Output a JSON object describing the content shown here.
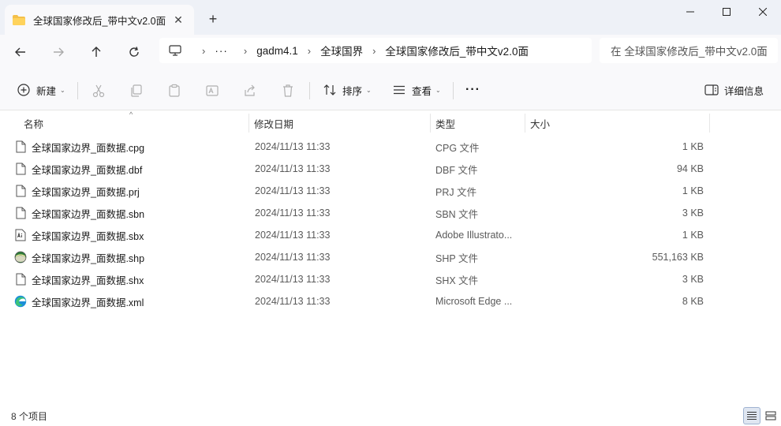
{
  "window": {
    "tab_title": "全球国家修改后_带中文v2.0面",
    "tab_close": "✕",
    "new_tab": "+"
  },
  "navigation": {
    "more": "···",
    "breadcrumbs": [
      "gadm4.1",
      "全球国界",
      "全球国家修改后_带中文v2.0面"
    ],
    "separator": "›",
    "search_placeholder": "在 全球国家修改后_带中文v2.0面"
  },
  "toolbar": {
    "new_label": "新建",
    "sort_label": "排序",
    "view_label": "查看",
    "more_label": "···",
    "details_label": "详细信息"
  },
  "columns": {
    "name": "名称",
    "modified": "修改日期",
    "type": "类型",
    "size": "大小"
  },
  "files": [
    {
      "name": "全球国家边界_面数据.cpg",
      "modified": "2024/11/13 11:33",
      "type": "CPG 文件",
      "size": "1 KB",
      "icon": "file-icon"
    },
    {
      "name": "全球国家边界_面数据.dbf",
      "modified": "2024/11/13 11:33",
      "type": "DBF 文件",
      "size": "94 KB",
      "icon": "file-icon"
    },
    {
      "name": "全球国家边界_面数据.prj",
      "modified": "2024/11/13 11:33",
      "type": "PRJ 文件",
      "size": "1 KB",
      "icon": "file-icon"
    },
    {
      "name": "全球国家边界_面数据.sbn",
      "modified": "2024/11/13 11:33",
      "type": "SBN 文件",
      "size": "3 KB",
      "icon": "file-icon"
    },
    {
      "name": "全球国家边界_面数据.sbx",
      "modified": "2024/11/13 11:33",
      "type": "Adobe Illustrato...",
      "size": "1 KB",
      "icon": "illustrator-file-icon"
    },
    {
      "name": "全球国家边界_面数据.shp",
      "modified": "2024/11/13 11:33",
      "type": "SHP 文件",
      "size": "551,163 KB",
      "icon": "shapefile-globe-icon"
    },
    {
      "name": "全球国家边界_面数据.shx",
      "modified": "2024/11/13 11:33",
      "type": "SHX 文件",
      "size": "3 KB",
      "icon": "file-icon"
    },
    {
      "name": "全球国家边界_面数据.xml",
      "modified": "2024/11/13 11:33",
      "type": "Microsoft Edge ...",
      "size": "8 KB",
      "icon": "edge-icon"
    }
  ],
  "status": {
    "item_count": "8 个项目"
  },
  "colors": {
    "titlebar_bg": "#eef1f7",
    "accent": "#0067c0"
  }
}
